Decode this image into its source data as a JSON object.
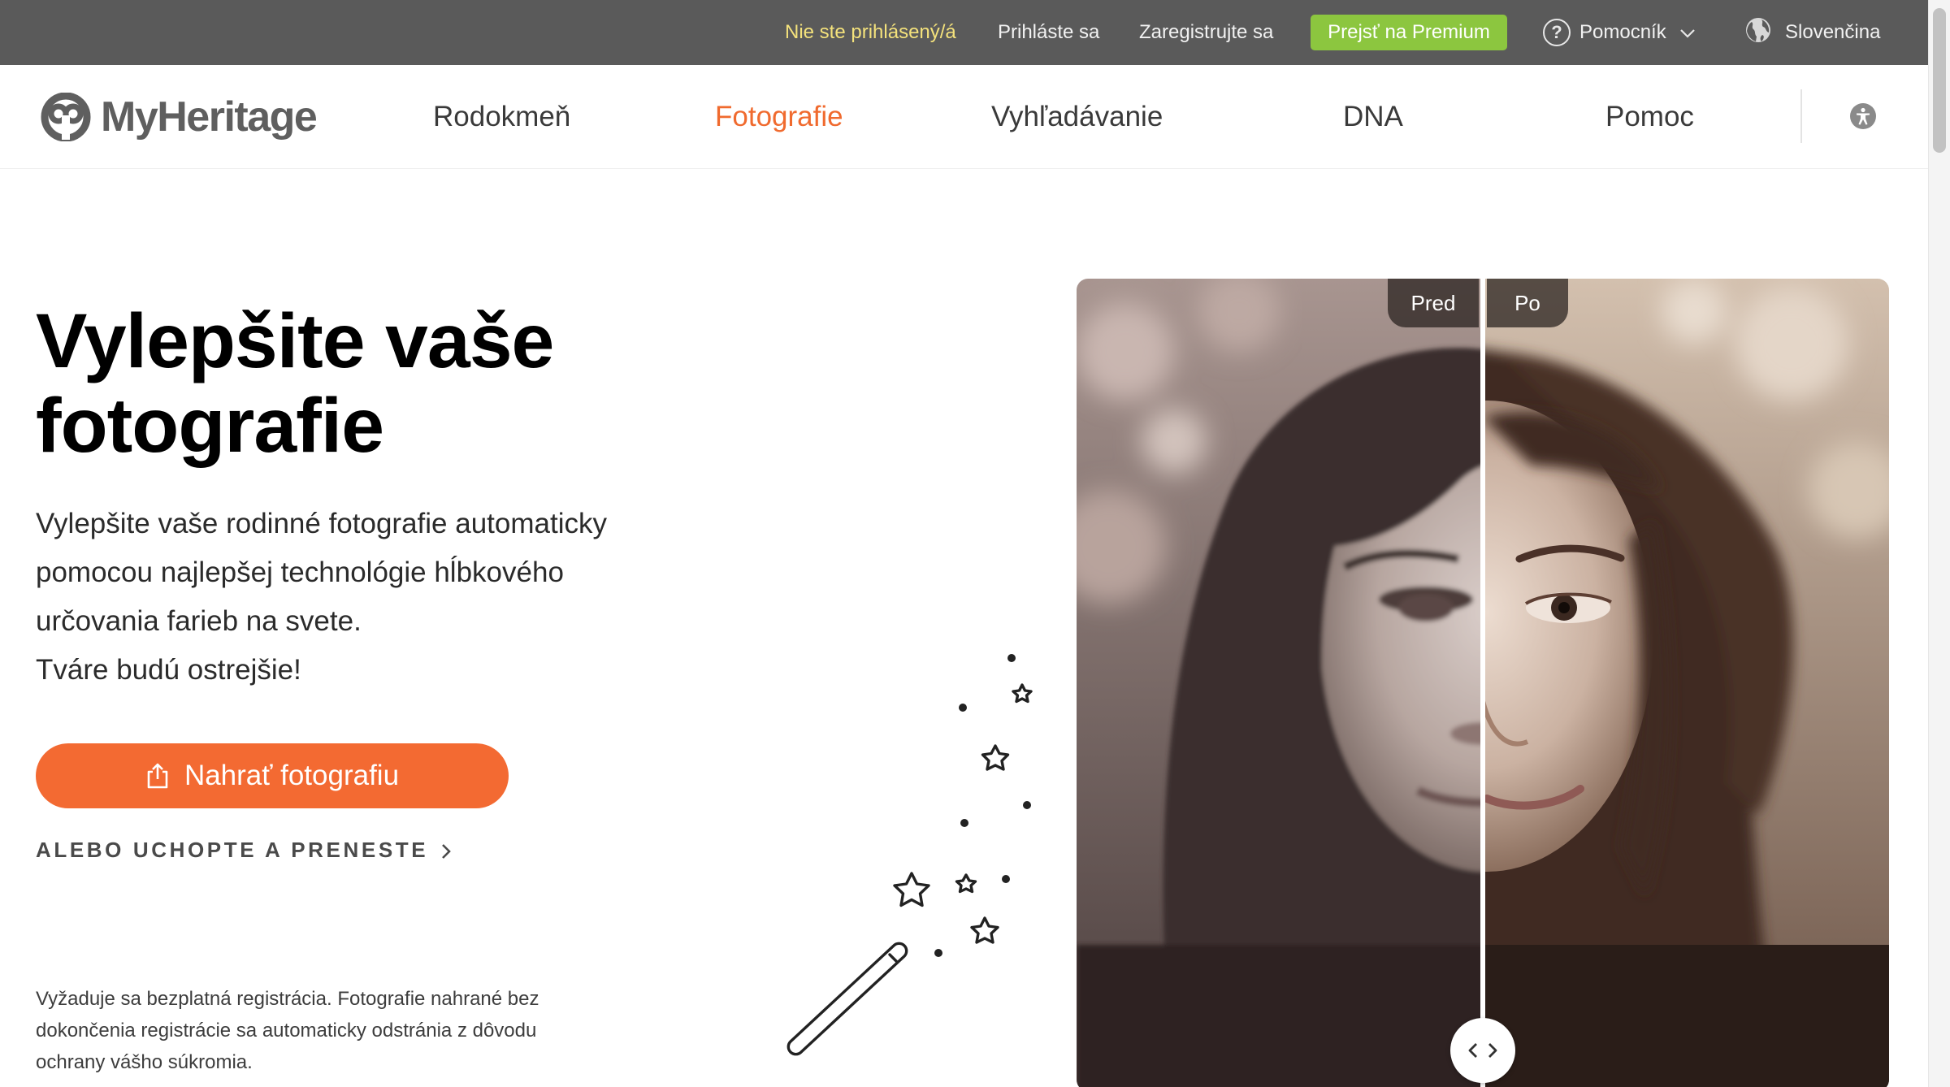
{
  "topbar": {
    "not_logged_in": "Nie ste prihlásený/á",
    "login": "Prihláste sa",
    "register": "Zaregistrujte sa",
    "premium": "Prejsť na Premium",
    "help": "Pomocník",
    "language": "Slovenčina"
  },
  "brand": {
    "name": "MyHeritage"
  },
  "nav": {
    "items": [
      {
        "label": "Rodokmeň",
        "active": false
      },
      {
        "label": "Fotografie",
        "active": true
      },
      {
        "label": "Vyhľadávanie",
        "active": false
      },
      {
        "label": "DNA",
        "active": false
      },
      {
        "label": "Pomoc",
        "active": false
      }
    ]
  },
  "hero": {
    "title_line1": "Vylepšite vaše",
    "title_line2": "fotografie",
    "desc_line1": "Vylepšite vaše rodinné fotografie automaticky",
    "desc_line2": "pomocou najlepšej technológie hĺbkového",
    "desc_line3": "určovania farieb na svete.",
    "desc_line4": "Tváre budú ostrejšie!",
    "upload_button": "Nahrať fotografiu",
    "drag_link": "ALEBO UCHOPTE A PRENESTE",
    "disclaimer_line1": "Vyžaduje sa bezplatná registrácia. Fotografie nahrané bez",
    "disclaimer_line2": "dokončenia registrácie sa automaticky odstránia z dôvodu",
    "disclaimer_line3": "ochrany vášho súkromia."
  },
  "compare": {
    "before_label": "Pred",
    "after_label": "Po",
    "split_position": 0.5
  },
  "colors": {
    "accent": "#f06a2e",
    "button": "#f36a32",
    "premium": "#8cc63f",
    "topbar": "#5a5a5a",
    "not_logged_in": "#f4e27c"
  }
}
